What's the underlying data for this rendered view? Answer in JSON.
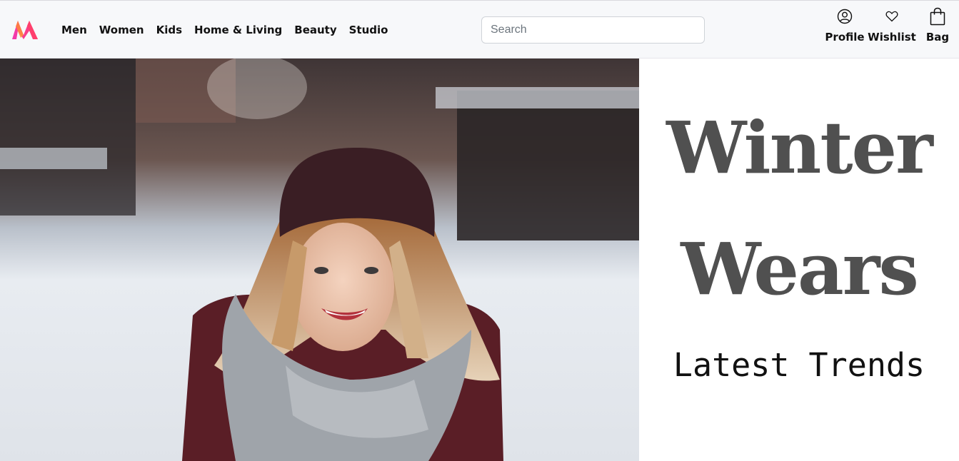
{
  "brand": {
    "logo_icon": "myntra-logo-icon",
    "colors": [
      "#f13ab1",
      "#fd913c",
      "#ff3f6c"
    ]
  },
  "nav": {
    "items": [
      {
        "label": "Men"
      },
      {
        "label": "Women"
      },
      {
        "label": "Kids"
      },
      {
        "label": "Home & Living"
      },
      {
        "label": "Beauty"
      },
      {
        "label": "Studio"
      }
    ]
  },
  "search": {
    "placeholder": "Search",
    "value": ""
  },
  "actions": {
    "profile": {
      "label": "Profile",
      "icon": "user-circle-icon"
    },
    "wishlist": {
      "label": "Wishlist",
      "icon": "heart-icon"
    },
    "bag": {
      "label": "Bag",
      "icon": "shopping-bag-icon"
    }
  },
  "hero": {
    "image_subject": "woman in beanie and scarf in snow",
    "headline_line1": "Winter",
    "headline_line2": "Wears",
    "subheadline": "Latest Trends",
    "headline_color": "#505050"
  }
}
